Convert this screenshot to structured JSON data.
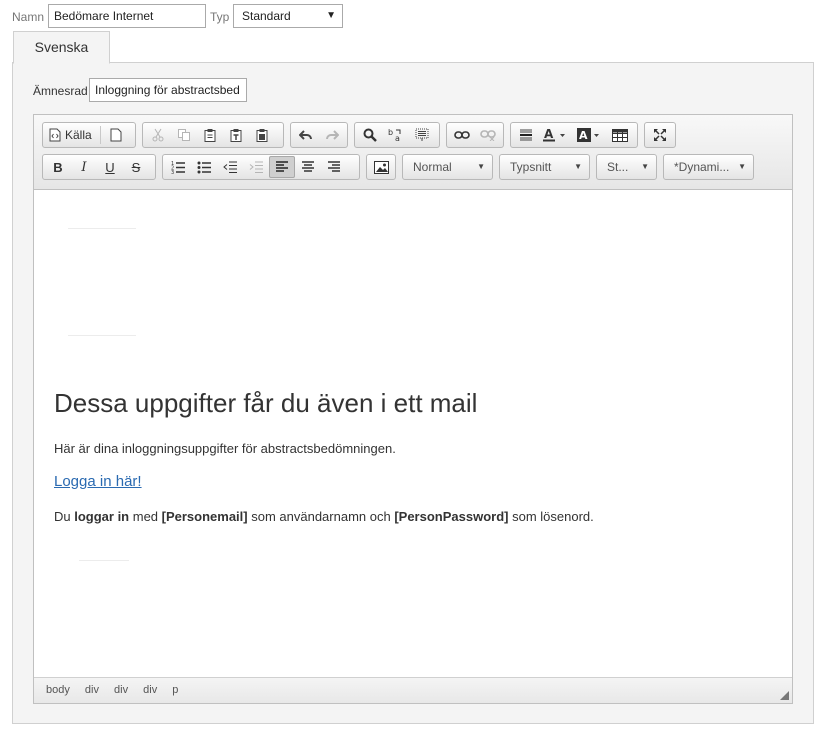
{
  "form": {
    "name_label": "Namn",
    "name_value": "Bedömare Internet",
    "type_label": "Typ",
    "type_value": "Standard",
    "type_arrow": "▼"
  },
  "tabs": [
    {
      "label": "Svenska",
      "active": true
    }
  ],
  "subject": {
    "label": "Ämnesrad",
    "value": "Inloggning för abstractsbed"
  },
  "toolbar": {
    "source_label": "Källa",
    "format_combo": "Normal",
    "font_combo": "Typsnitt",
    "size_combo": "St...",
    "dynamic_combo": "*Dynami..."
  },
  "content": {
    "heading": "Dessa uppgifter får du även i ett mail",
    "paragraph": "Här är dina inloggningsuppgifter för abstractsbedömningen.",
    "link_text": "Logga in här!",
    "login_line": {
      "pre": "Du ",
      "bold1": "loggar in",
      "mid1": " med ",
      "bold2": "[Personemail]",
      "mid2": " som användarnamn och ",
      "bold3": "[PersonPassword]",
      "post": " som lösenord."
    }
  },
  "statusbar": {
    "path": [
      "body",
      "div",
      "div",
      "div",
      "p"
    ]
  },
  "colors": {
    "link": "#2a6ab1",
    "panel_bg": "#f4f4f4",
    "toolbar_bg": "#e6e6e6"
  }
}
